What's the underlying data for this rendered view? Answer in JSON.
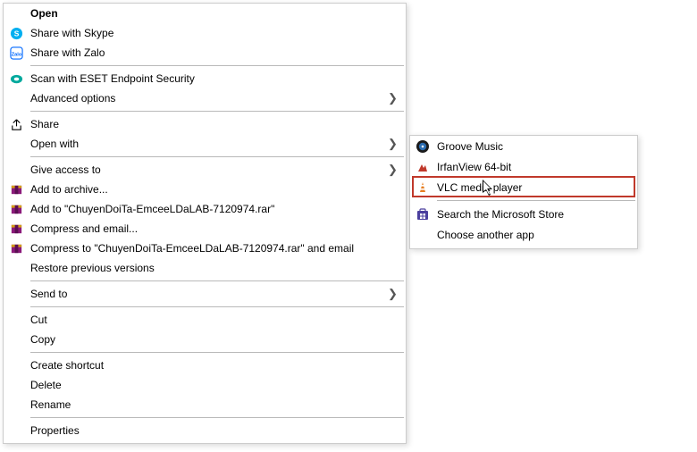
{
  "main_menu": {
    "open": "Open",
    "share_skype": "Share with Skype",
    "share_zalo": "Share with Zalo",
    "scan_eset": "Scan with ESET Endpoint Security",
    "advanced_options": "Advanced options",
    "share": "Share",
    "open_with": "Open with",
    "give_access_to": "Give access to",
    "add_to_archive": "Add to archive...",
    "add_to_named_archive": "Add to \"ChuyenDoiTa-EmceeLDaLAB-7120974.rar\"",
    "compress_email": "Compress and email...",
    "compress_to_named_email": "Compress to \"ChuyenDoiTa-EmceeLDaLAB-7120974.rar\" and email",
    "restore_previous": "Restore previous versions",
    "send_to": "Send to",
    "cut": "Cut",
    "copy": "Copy",
    "create_shortcut": "Create shortcut",
    "delete": "Delete",
    "rename": "Rename",
    "properties": "Properties"
  },
  "submenu": {
    "groove": "Groove Music",
    "irfanview": "IrfanView 64-bit",
    "vlc": "VLC media player",
    "search_store": "Search the Microsoft Store",
    "choose_another": "Choose another app"
  }
}
